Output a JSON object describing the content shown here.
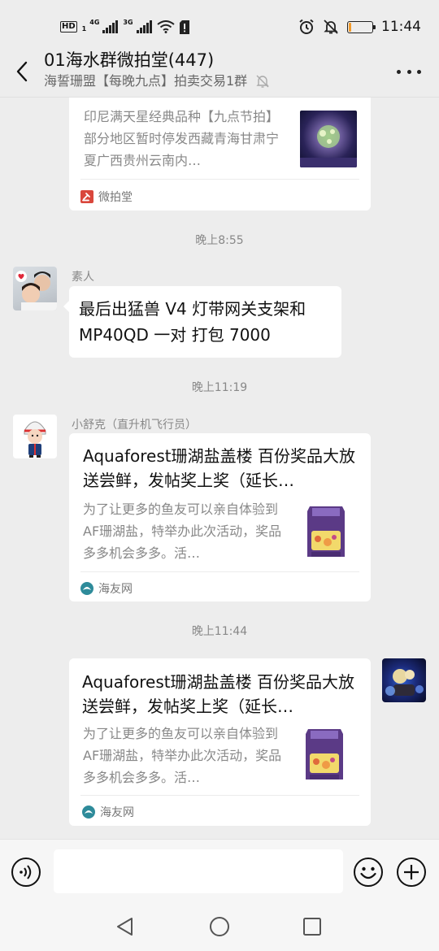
{
  "status_bar": {
    "hd": "HD",
    "hd_sub": "1",
    "net1": "4G",
    "net2": "3G",
    "battery_level_percent": 12,
    "time": "11:44"
  },
  "header": {
    "title": "01海水群微拍堂(447)",
    "subtitle": "海誓珊盟【每晚九点】拍卖交易1群"
  },
  "messages": {
    "card1": {
      "desc": "印尼满天星经典品种【九点节拍】部分地区暂时停发西藏青海甘肃宁夏广西贵州云南内…",
      "source": "微拍堂"
    },
    "ts1": "晚上8:55",
    "msg1": {
      "sender": "素人",
      "text": "最后出猛兽 V4 灯带网关支架和 MP40QD 一对 打包 7000"
    },
    "ts2": "晚上11:19",
    "msg2": {
      "sender": "小舒克（直升机飞行员）",
      "title": "Aquaforest珊湖盐盖楼 百份奖品大放送尝鲜，发帖奖上奖（延长…",
      "desc": "为了让更多的鱼友可以亲自体验到AF珊湖盐，特举办此次活动，奖品多多机会多多。活…",
      "source": "海友网"
    },
    "ts3": "晚上11:44",
    "msg3": {
      "title": "Aquaforest珊湖盐盖楼 百份奖品大放送尝鲜，发帖奖上奖（延长…",
      "desc": "为了让更多的鱼友可以亲自体验到AF珊湖盐，特举办此次活动，奖品多多机会多多。活…",
      "source": "海友网"
    }
  },
  "icons": {
    "back": "chevron-left-icon",
    "more": "more-icon",
    "mute": "bell-off-icon",
    "voice": "voice-icon",
    "emoji": "emoji-icon",
    "plus": "plus-icon"
  },
  "colors": {
    "background": "#ededed",
    "bubble": "#ffffff",
    "battery": "#f39b2b",
    "weipaitang": "#d9473c",
    "haiyou": "#2e8b9a"
  }
}
